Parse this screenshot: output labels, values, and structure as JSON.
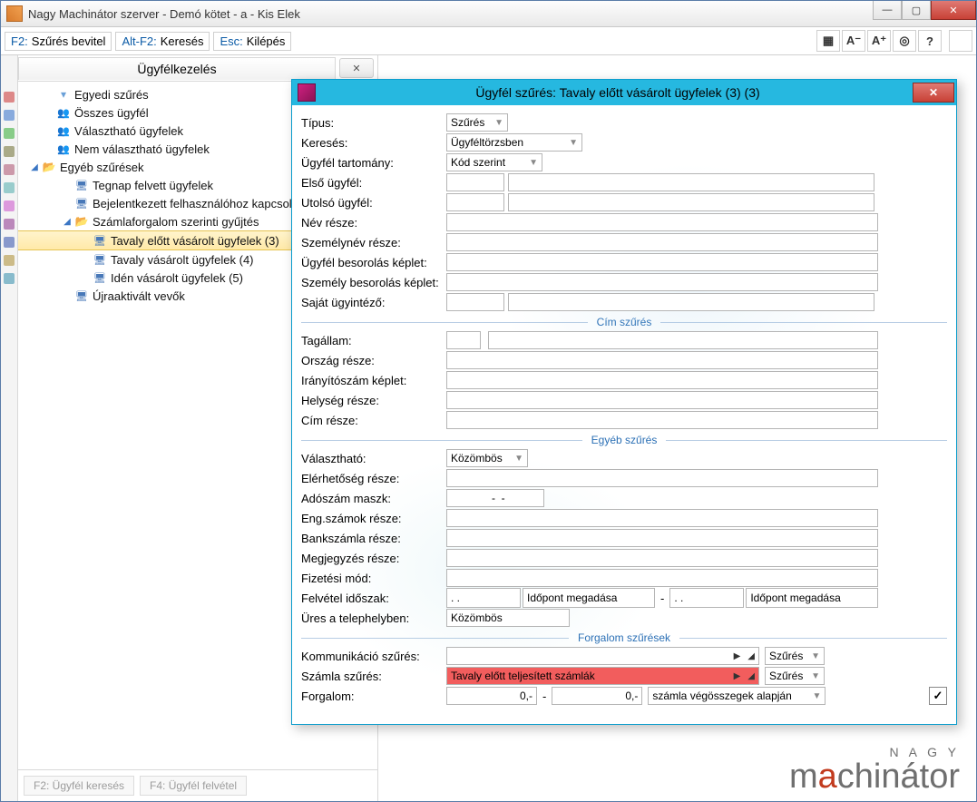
{
  "window": {
    "title": "Nagy Machinátor szerver - Demó kötet - a - Kis Elek"
  },
  "toolbar": {
    "f2_key": "F2:",
    "f2_label": "Szűrés bevitel",
    "altf2_key": "Alt-F2:",
    "altf2_label": "Keresés",
    "esc_key": "Esc:",
    "esc_label": "Kilépés"
  },
  "sidebar": {
    "title": "Ügyfélkezelés",
    "items": [
      {
        "label": "Egyedi szűrés"
      },
      {
        "label": "Összes ügyfél"
      },
      {
        "label": "Választható ügyfelek"
      },
      {
        "label": "Nem választható ügyfelek"
      },
      {
        "label": "Egyéb szűrések"
      },
      {
        "label": "Tegnap felvett ügyfelek"
      },
      {
        "label": "Bejelentkezett felhasználóhoz kapcsolt ügyfelek"
      },
      {
        "label": "Számlaforgalom szerinti gyűjtés"
      },
      {
        "label": "Tavaly előtt vásárolt ügyfelek (3)"
      },
      {
        "label": "Tavaly vásárolt ügyfelek (4)"
      },
      {
        "label": "Idén vásárolt ügyfelek (5)"
      },
      {
        "label": "Újraaktivált vevők"
      }
    ],
    "footer": {
      "f2": "F2: Ügyfél keresés",
      "f4": "F4: Ügyfél felvétel"
    }
  },
  "dialog": {
    "title": "Ügyfél szűrés: Tavaly előtt vásárolt ügyfelek (3) (3)",
    "labels": {
      "tipus": "Típus:",
      "kereses": "Keresés:",
      "tartomany": "Ügyfél tartomány:",
      "elso": "Első ügyfél:",
      "utolso": "Utolsó ügyfél:",
      "nev": "Név része:",
      "szemelynev": "Személynév része:",
      "besorolas": "Ügyfél besorolás képlet:",
      "szbesorolas": "Személy besorolás képlet:",
      "sajat": "Saját ügyintéző:",
      "cim_sec": "Cím szűrés",
      "tagallam": "Tagállam:",
      "orszag": "Ország része:",
      "irsz": "Irányítószám képlet:",
      "helyseg": "Helység része:",
      "cimr": "Cím része:",
      "egyeb_sec": "Egyéb szűrés",
      "valaszthato": "Választható:",
      "elerhetoseg": "Elérhetőség része:",
      "adoszam": "Adószám maszk:",
      "engszam": "Eng.számok része:",
      "bank": "Bankszámla része:",
      "megj": "Megjegyzés része:",
      "fizmod": "Fizetési mód:",
      "felvetel": "Felvétel időszak:",
      "idopont": "Időpont megadása",
      "ures": "Üres a telephelyben:",
      "forg_sec": "Forgalom szűrések",
      "komm": "Kommunikáció szűrés:",
      "szamla": "Számla szűrés:",
      "szamla_val": "Tavaly előtt teljesített számlák",
      "forgalom": "Forgalom:",
      "szures": "Szűrés",
      "forgalom_base": "számla végösszegek alapján"
    },
    "values": {
      "tipus": "Szűrés",
      "kereses": "Ügyféltörzsben",
      "tartomany": "Kód szerint",
      "valaszthato": "Közömbös",
      "adoszam": "  -  -",
      "date_mask": ".   .",
      "ures": "Közömbös",
      "zero": "0,-",
      "dash": "-",
      "check": "✓"
    }
  },
  "brand": {
    "small": "N A G Y",
    "big_pre": "m",
    "big_accent": "a",
    "big_post": "chinátor"
  }
}
